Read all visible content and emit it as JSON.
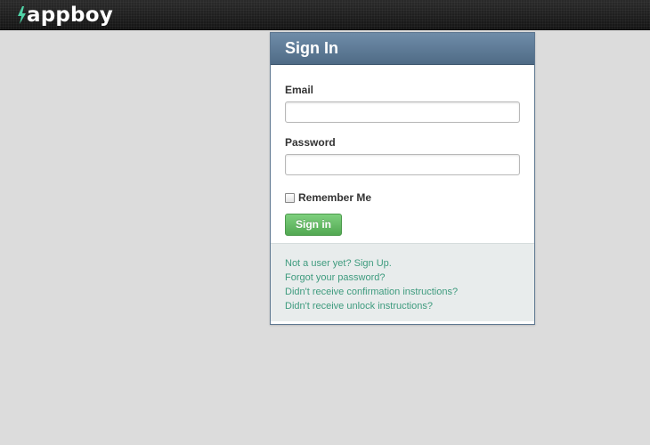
{
  "header": {
    "logo_text": "appboy",
    "logo_icon": "lightning-bolt-icon",
    "accent_color": "#4fd1a5"
  },
  "signin": {
    "title": "Sign In",
    "email_label": "Email",
    "email_value": "",
    "password_label": "Password",
    "password_value": "",
    "remember_label": "Remember Me",
    "remember_checked": false,
    "submit_label": "Sign in"
  },
  "links": [
    {
      "label": "Not a user yet? Sign Up."
    },
    {
      "label": "Forgot your password?"
    },
    {
      "label": "Didn't receive confirmation instructions?"
    },
    {
      "label": "Didn't receive unlock instructions?"
    }
  ],
  "colors": {
    "link": "#3e9b7e",
    "button": "#5cb35c",
    "header": "#5d7a96"
  }
}
